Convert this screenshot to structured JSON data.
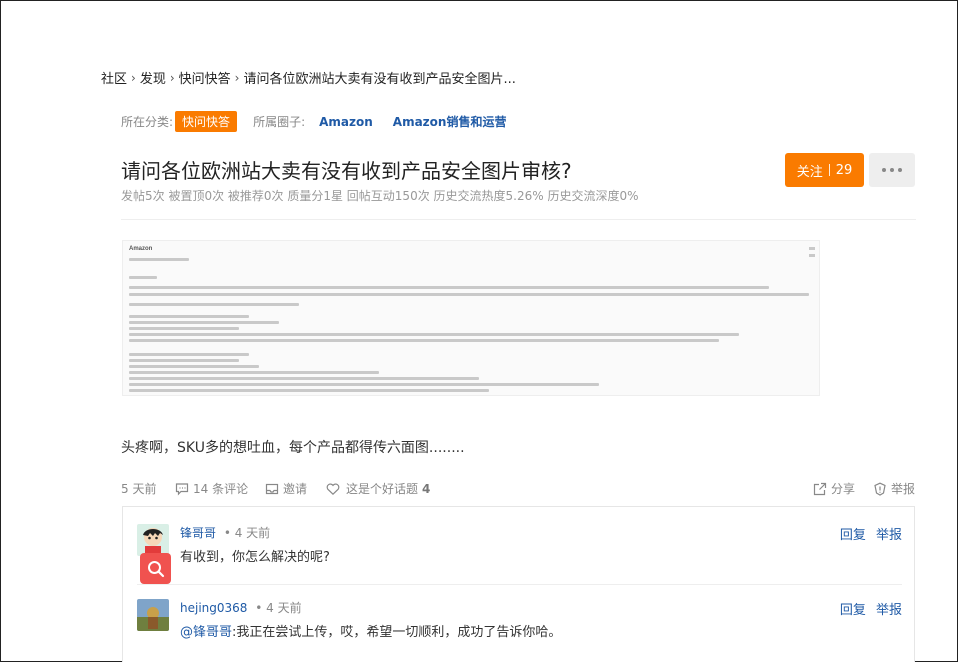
{
  "breadcrumb": {
    "items": [
      "社区",
      "发现",
      "快问快答",
      "请问各位欧洲站大卖有没有收到产品安全图片..."
    ],
    "separator": "›"
  },
  "meta": {
    "category_label": "所在分类:",
    "category_tag": "快问快答",
    "circle_label": "所属圈子:",
    "circles": [
      "Amazon",
      "Amazon销售和运营"
    ]
  },
  "post": {
    "title": "请问各位欧洲站大卖有没有收到产品安全图片审核?",
    "stats": "发帖5次 被置顶0次 被推荐0次 质量分1星 回帖互动150次 历史交流热度5.26% 历史交流深度0%",
    "follow_label": "关注",
    "follow_count": "29",
    "image_heading": "Amazon",
    "body": "头疼啊，SKU多的想吐血，每个产品都得传六面图........"
  },
  "actions": {
    "time": "5 天前",
    "comments": "14 条评论",
    "invite": "邀请",
    "good_topic": "这是个好话题",
    "good_count": "4",
    "share": "分享",
    "report": "举报"
  },
  "comments": [
    {
      "user": "锋哥哥",
      "time": "• 4 天前",
      "text": "有收到，你怎么解决的呢?",
      "reply": "回复",
      "report": "举报"
    },
    {
      "user": "hejing0368",
      "time": "• 4 天前",
      "mention": "@锋哥哥",
      "text": ":我正在尝试上传，哎，希望一切顺利，成功了告诉你哈。",
      "reply": "回复",
      "report": "举报"
    }
  ],
  "colors": {
    "accent": "#fa7b00",
    "link": "#1f5aa6",
    "search_fab": "#f0524f"
  }
}
